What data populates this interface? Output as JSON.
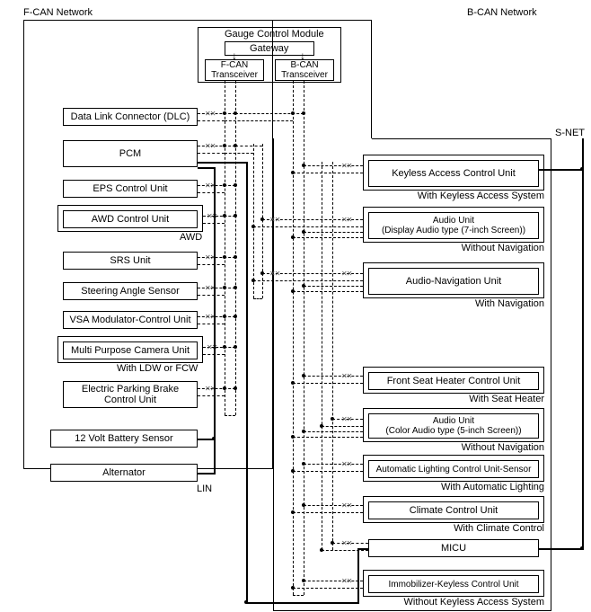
{
  "networks": {
    "fcan": "F-CAN Network",
    "bcan": "B-CAN Network",
    "snet": "S-NET"
  },
  "gauge": {
    "title": "Gauge Control Module",
    "gateway": "Gateway",
    "fcan_trans": "F-CAN\nTransceiver",
    "bcan_trans": "B-CAN\nTransceiver"
  },
  "left_boxes": {
    "dlc": "Data Link Connector (DLC)",
    "pcm": "PCM",
    "eps": "EPS Control Unit",
    "awd": "AWD Control Unit",
    "awd_note": "AWD",
    "srs": "SRS Unit",
    "steer": "Steering Angle Sensor",
    "vsa": "VSA Modulator-Control Unit",
    "camera": "Multi Purpose Camera Unit",
    "camera_note": "With LDW or FCW",
    "epb": "Electric Parking Brake\nControl Unit",
    "battery": "12 Volt Battery Sensor",
    "alternator": "Alternator",
    "lin": "LIN"
  },
  "right_boxes": {
    "keyless": "Keyless Access Control Unit",
    "keyless_note": "With Keyless Access System",
    "audio7": "Audio Unit\n(Display Audio type (7-inch Screen))",
    "audio7_note": "Without Navigation",
    "audionav": "Audio-Navigation Unit",
    "audionav_note": "With Navigation",
    "seatheater": "Front Seat Heater Control Unit",
    "seatheater_note": "With Seat Heater",
    "audio5": "Audio Unit\n(Color Audio type (5-inch Screen))",
    "audio5_note": "Without Navigation",
    "autolight": "Automatic Lighting Control Unit-Sensor",
    "autolight_note": "With Automatic Lighting",
    "climate": "Climate Control Unit",
    "climate_note": "With Climate Control",
    "micu": "MICU",
    "immo": "Immobilizer-Keyless Control Unit",
    "immo_note": "Without Keyless Access System"
  }
}
